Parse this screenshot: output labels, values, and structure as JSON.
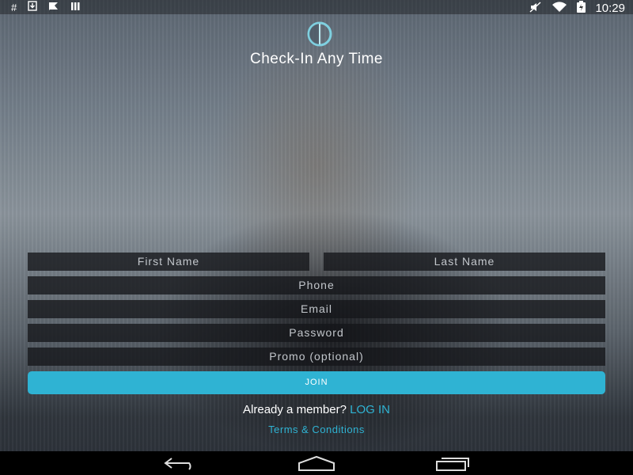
{
  "status_bar": {
    "time": "10:29",
    "left_icons": [
      "hash-icon",
      "download-icon",
      "flag-icon",
      "signal-bars-icon"
    ],
    "right_icons": [
      "mute-icon",
      "wifi-icon",
      "battery-charging-icon"
    ]
  },
  "app": {
    "logo": "app-logo",
    "tagline": "Check-In Any Time"
  },
  "form": {
    "first_name_placeholder": "First Name",
    "last_name_placeholder": "Last Name",
    "phone_placeholder": "Phone",
    "email_placeholder": "Email",
    "password_placeholder": "Password",
    "promo_placeholder": "Promo (optional)",
    "join_label": "JOIN"
  },
  "footer": {
    "member_text": "Already a member?",
    "login_link": "LOG IN",
    "terms_link": "Terms & Conditions"
  },
  "nav": {
    "icons": [
      "back-icon",
      "home-icon",
      "recents-icon"
    ]
  },
  "colors": {
    "accent": "#2fb3d3",
    "field_bg": "#14161a"
  }
}
